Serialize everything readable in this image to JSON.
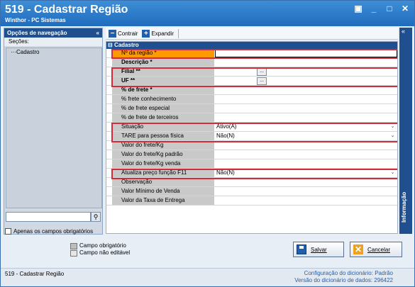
{
  "window": {
    "title": "519 - Cadastrar Região",
    "subtitle": "Winthor - PC Sistemas"
  },
  "nav": {
    "header": "Opções de navegação",
    "collapse": "«",
    "sections_label": "Seções:",
    "tree": [
      "Cadastro"
    ],
    "search_placeholder": "",
    "only_required_label": "Apenas os campos obrigatórios"
  },
  "toolbar": {
    "collapse": "Contrair",
    "expand": "Expandir"
  },
  "grid": {
    "category": "Cadastro",
    "rows": [
      {
        "label": "Nº da região *",
        "value": ""
      },
      {
        "label": "Descrição *",
        "value": ""
      },
      {
        "label": "Filial **",
        "value": ""
      },
      {
        "label": "UF **",
        "value": ""
      },
      {
        "label": "% de frete *",
        "value": ""
      },
      {
        "label": "% frete conhecimento",
        "value": ""
      },
      {
        "label": "% de frete especial",
        "value": ""
      },
      {
        "label": "% de frete de terceiros",
        "value": ""
      },
      {
        "label": "Situação",
        "value": "Ativo(A)"
      },
      {
        "label": "TARE para pessoa física",
        "value": "Não(N)"
      },
      {
        "label": "Valor do frete/Kg",
        "value": ""
      },
      {
        "label": "Valor do frete/Kg padrão",
        "value": ""
      },
      {
        "label": "Valor do frete/Kg venda",
        "value": ""
      },
      {
        "label": "Atualiza preço função F11",
        "value": "Não(N)"
      },
      {
        "label": "Observação",
        "value": ""
      },
      {
        "label": "Valor Mínimo de Venda",
        "value": ""
      },
      {
        "label": "Valor da Taxa de Entrega",
        "value": ""
      }
    ]
  },
  "side_tab": "Informação",
  "legend": {
    "required": "Campo obrigatório",
    "not_editable": "Campo não editável"
  },
  "buttons": {
    "save": "Salvar",
    "cancel": "Cancelar"
  },
  "status": {
    "left": "519 - Cadastrar Região",
    "dict_config_label": "Configuração do dicionário:",
    "dict_config_value": "Padrão",
    "dict_version_label": "Versão do dicionário de dados:",
    "dict_version_value": "296422"
  },
  "colors": {
    "accent": "#1f4f8f",
    "required": "#ff9900",
    "highlight": "#d42b3a"
  }
}
